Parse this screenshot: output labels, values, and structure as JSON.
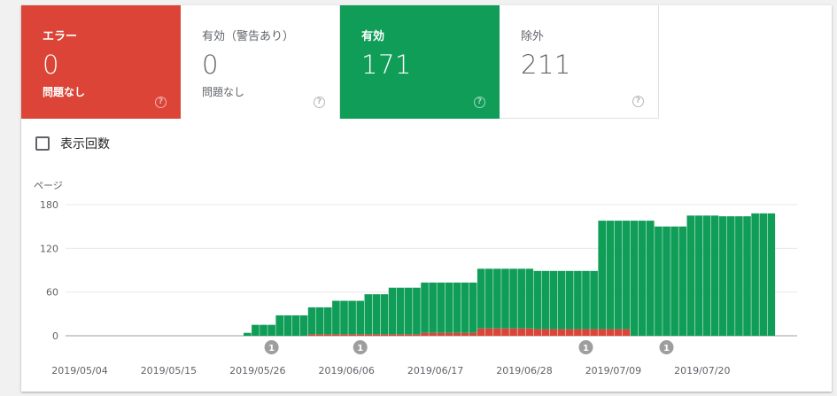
{
  "tiles": [
    {
      "key": "error",
      "label": "エラー",
      "count": "0",
      "sub": "問題なし",
      "color": "#db4437"
    },
    {
      "key": "warn",
      "label": "有効（警告あり）",
      "count": "0",
      "sub": "問題なし",
      "color": "#ffffff"
    },
    {
      "key": "valid",
      "label": "有効",
      "count": "171",
      "sub": "",
      "color": "#0f9d58"
    },
    {
      "key": "excluded",
      "label": "除外",
      "count": "211",
      "sub": "",
      "color": "#ffffff"
    }
  ],
  "help_glyph": "?",
  "impressions": {
    "label": "表示回数",
    "checked": false
  },
  "chart_data": {
    "type": "bar",
    "stacked": true,
    "ylabel": "ページ",
    "ylim": [
      0,
      180
    ],
    "yticks": [
      "0",
      "60",
      "120",
      "180"
    ],
    "grid": true,
    "series": [
      {
        "key": "error",
        "color": "#db4437",
        "values": [
          0,
          0,
          0,
          0,
          0,
          0,
          0,
          0,
          0,
          0,
          0,
          0,
          0,
          0,
          0,
          0,
          0,
          0,
          0,
          0,
          0,
          0,
          0,
          0,
          0,
          0,
          0,
          0,
          0,
          0,
          0,
          0,
          0,
          0,
          0,
          0,
          0,
          0,
          0,
          0,
          0,
          0,
          0,
          0,
          0,
          0,
          0,
          0,
          0,
          0,
          0,
          0,
          0,
          0,
          0,
          0,
          0,
          0,
          0,
          0,
          0,
          0,
          0,
          0,
          0,
          0,
          0,
          0,
          0,
          0,
          0,
          0,
          0,
          0,
          0,
          0,
          0,
          0,
          0,
          0,
          0,
          0,
          0,
          0,
          0
        ]
      },
      {
        "key": "valid",
        "color": "#0f9d58",
        "values": [
          0,
          0,
          0,
          0,
          0,
          0,
          0,
          0,
          0,
          0,
          0,
          0,
          0,
          0,
          0,
          0,
          0,
          0,
          0,
          0,
          0,
          0,
          0,
          0,
          0,
          0,
          4,
          15,
          15,
          15,
          28,
          28,
          28,
          28,
          37,
          37,
          37,
          46,
          46,
          46,
          46,
          55,
          55,
          55,
          64,
          64,
          64,
          64,
          69,
          69,
          69,
          69,
          69,
          69,
          69,
          82,
          82,
          82,
          82,
          82,
          82,
          82,
          80,
          80,
          80,
          80,
          80,
          80,
          80,
          80,
          149,
          149,
          149,
          149,
          158,
          158,
          158,
          150,
          150,
          150,
          150,
          165,
          165,
          165,
          165,
          164,
          164,
          164,
          164,
          168,
          168,
          168
        ]
      },
      {
        "key": "error_stack",
        "color": "#db4437",
        "values": [
          0,
          0,
          0,
          0,
          0,
          0,
          0,
          0,
          0,
          0,
          0,
          0,
          0,
          0,
          0,
          0,
          0,
          0,
          0,
          0,
          0,
          0,
          0,
          0,
          0,
          0,
          0,
          0,
          0,
          0,
          0,
          0,
          0,
          0,
          2,
          2,
          2,
          2,
          2,
          2,
          2,
          2,
          2,
          2,
          2,
          2,
          2,
          2,
          4,
          4,
          4,
          4,
          4,
          4,
          4,
          10,
          10,
          10,
          10,
          10,
          10,
          10,
          9,
          9,
          9,
          9,
          9,
          9,
          9,
          9,
          9,
          9,
          9,
          9,
          0,
          0,
          0,
          0,
          0,
          0,
          0,
          0,
          0,
          0,
          0,
          0,
          0,
          0,
          0,
          0,
          0,
          0
        ]
      }
    ],
    "categories_start": "2019/05/04",
    "xticks": [
      "2019/05/04",
      "2019/05/15",
      "2019/05/26",
      "2019/06/06",
      "2019/06/17",
      "2019/06/28",
      "2019/07/09",
      "2019/07/20"
    ],
    "annotations": [
      {
        "label": "1",
        "x_index": 29
      },
      {
        "label": "1",
        "x_index": 40
      },
      {
        "label": "1",
        "x_index": 68
      },
      {
        "label": "1",
        "x_index": 78
      }
    ]
  }
}
